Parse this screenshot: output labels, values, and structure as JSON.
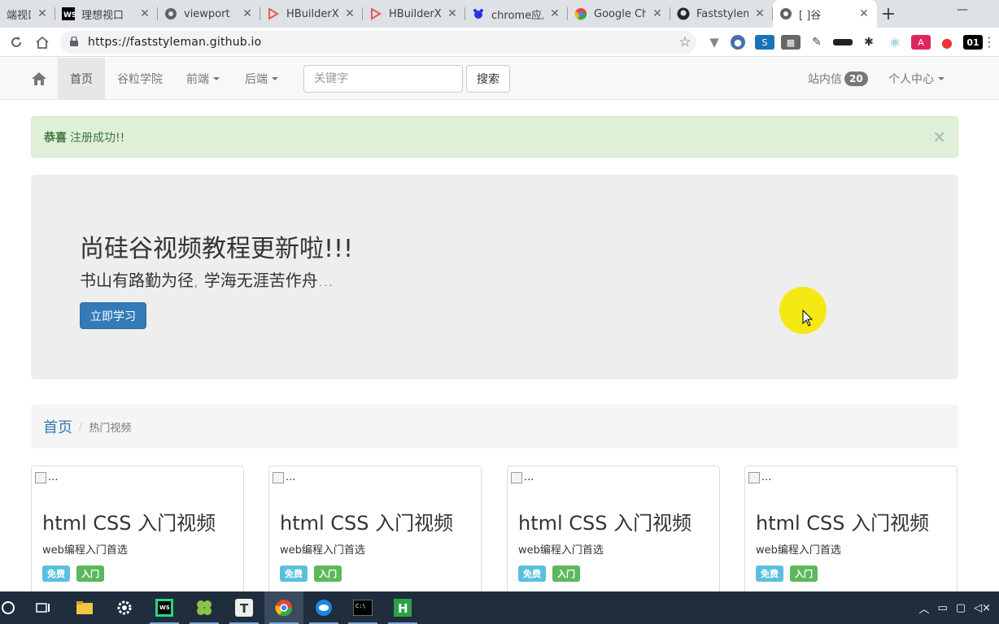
{
  "browser": {
    "tabs": [
      {
        "title": "端视口",
        "icon": "globe-icon"
      },
      {
        "title": "理想视口",
        "icon": "webstorm-icon"
      },
      {
        "title": "viewport",
        "icon": "globe-icon"
      },
      {
        "title": "HBuilderX",
        "icon": "hbuilder-icon"
      },
      {
        "title": "HBuilderX",
        "icon": "hbuilder-icon"
      },
      {
        "title": "chrome应用",
        "icon": "baidu-icon"
      },
      {
        "title": "Google Ch",
        "icon": "google-icon"
      },
      {
        "title": "Faststylem",
        "icon": "github-icon"
      },
      {
        "title": "[      ]谷",
        "icon": "globe-icon"
      }
    ],
    "url": "https://faststyleman.github.io"
  },
  "navbar": {
    "items": [
      {
        "label": "首页"
      },
      {
        "label": "谷粒学院"
      },
      {
        "label": "前端"
      },
      {
        "label": "后端"
      }
    ],
    "search_placeholder": "关键字",
    "search_button": "搜索",
    "messages_label": "站内信",
    "messages_count": "20",
    "user_menu": "个人中心"
  },
  "alert": {
    "strong": "恭喜",
    "text": "注册成功!!",
    "close": "×"
  },
  "jumbotron": {
    "title": "尚硅谷视频教程更新啦!!!",
    "subtitle": "书山有路勤为径, 学海无涯苦作舟...",
    "button": "立即学习"
  },
  "breadcrumb": {
    "home": "首页",
    "separator": "/",
    "current": "热门视频"
  },
  "cards": [
    {
      "img_alt": "...",
      "title": "html CSS 入门视频",
      "desc": "web编程入门首选",
      "tag1": "免费",
      "tag2": "入门"
    },
    {
      "img_alt": "...",
      "title": "html CSS 入门视频",
      "desc": "web编程入门首选",
      "tag1": "免费",
      "tag2": "入门"
    },
    {
      "img_alt": "...",
      "title": "html CSS 入门视频",
      "desc": "web编程入门首选",
      "tag1": "免费",
      "tag2": "入门"
    },
    {
      "img_alt": "...",
      "title": "html CSS 入门视频",
      "desc": "web编程入门首选",
      "tag1": "免费",
      "tag2": "入门"
    }
  ],
  "colors": {
    "primary": "#337ab7",
    "success_bg": "#dff0d8",
    "label_info": "#5bc0de",
    "label_success": "#5cb85c"
  }
}
